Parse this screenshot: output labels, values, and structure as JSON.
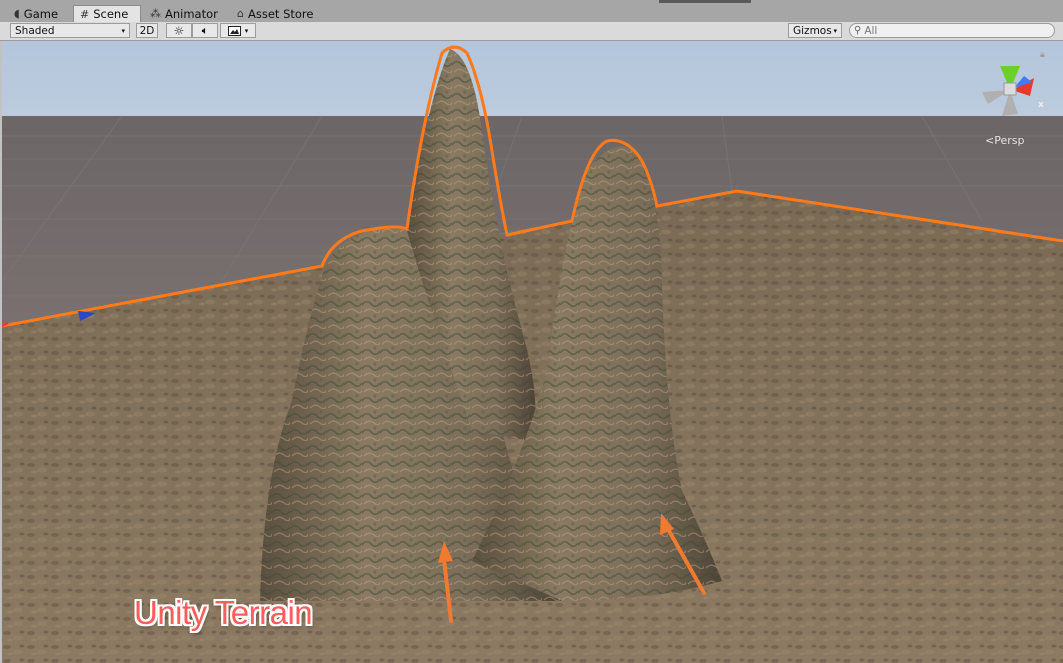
{
  "tabs": [
    {
      "label": "Game",
      "icon": "pacman-icon",
      "active": false
    },
    {
      "label": "Scene",
      "icon": "grid-icon",
      "active": true
    },
    {
      "label": "Animator",
      "icon": "animator-icon",
      "active": false
    },
    {
      "label": "Asset Store",
      "icon": "shopping-bag-icon",
      "active": false
    }
  ],
  "toolbar": {
    "draw_mode": "Shaded",
    "two_d_label": "2D",
    "lighting_icon": "sun-icon",
    "audio_icon": "speaker-icon",
    "effects_icon": "image-icon",
    "gizmos_label": "Gizmos",
    "search_placeholder": "All"
  },
  "scene": {
    "projection_label": "Persp",
    "axis_label": "x",
    "caption": "Unity Terrain",
    "selection_color": "#ff7a1a",
    "annotation_color": "#f07a30",
    "caption_color": "#ff5c5c"
  }
}
